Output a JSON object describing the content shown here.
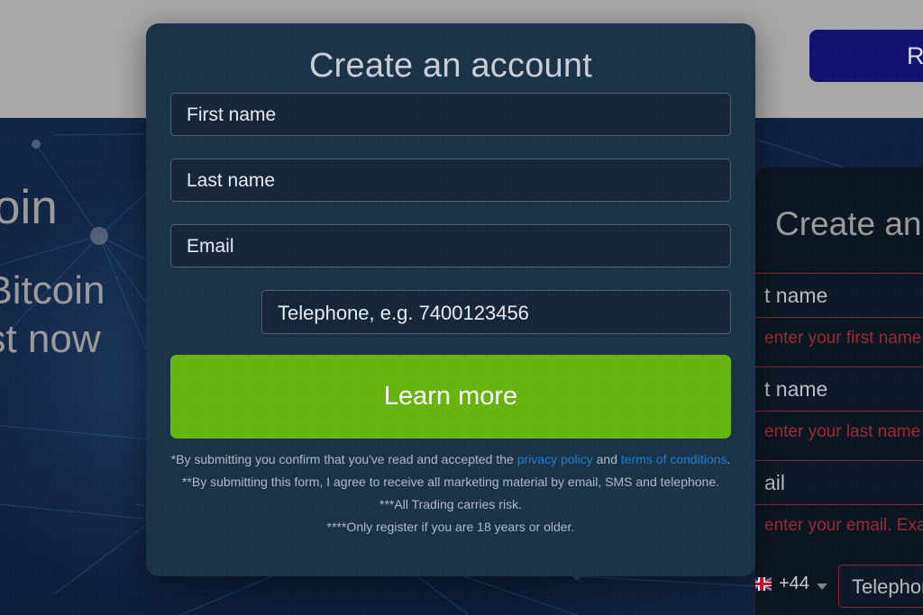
{
  "page": {
    "background_style": "dark-blue-constellation-network"
  },
  "header": {
    "register_button_label": "R"
  },
  "hero": {
    "title": "itcoin",
    "line1": "ct Bitcoin",
    "line2": "vest now"
  },
  "modal": {
    "title": "Create an account",
    "fields": {
      "first_name_placeholder": "First name",
      "last_name_placeholder": "Last name",
      "email_placeholder": "Email",
      "phone_placeholder": "Telephone, e.g. 7400123456"
    },
    "phone": {
      "country_flag": "uk-flag-icon",
      "dial_code": "+44",
      "caret": "chevron-down-icon"
    },
    "submit_label": "Learn more",
    "disclaimers": {
      "line1_pre": "*By submitting you confirm that you've read and accepted the ",
      "line1_link1": "privacy policy",
      "line1_mid": " and ",
      "line1_link2": "terms of conditions",
      "line1_post": ".",
      "line2": "**By submitting this form, I agree to receive all marketing material by email, SMS and telephone.",
      "line3": "***All Trading carries risk.",
      "line4": "****Only register if you are 18 years or older."
    }
  },
  "background_form": {
    "title": "Create an",
    "first_name_label": "t name",
    "first_name_error": "enter your first name (N",
    "last_name_label": "t name",
    "last_name_error": "enter your last name (N",
    "email_label": "ail",
    "email_error": "enter your email. Exam",
    "phone": {
      "country_flag": "uk-flag-icon",
      "dial_code": "+44",
      "placeholder": "Telephone, e"
    }
  },
  "colors": {
    "accent_green": "#67b310",
    "link_blue": "#1a7fd4",
    "modal_bg": "#1b3349",
    "input_bg": "#15263a",
    "error_red": "#9c2b33",
    "header_grey": "#a8a8a8",
    "register_navy": "#121270"
  }
}
